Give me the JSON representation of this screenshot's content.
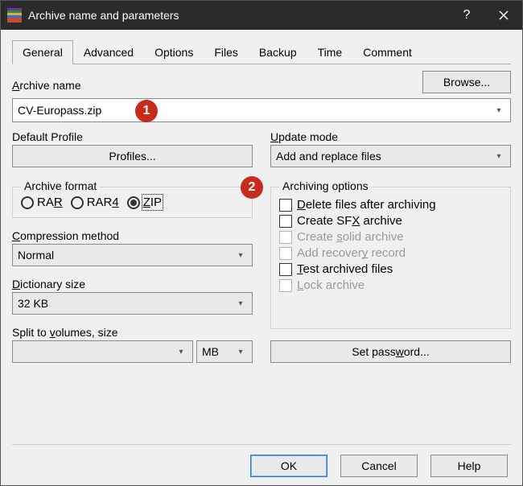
{
  "window": {
    "title": "Archive name and parameters"
  },
  "tabs": {
    "general": "General",
    "advanced": "Advanced",
    "options": "Options",
    "files": "Files",
    "backup": "Backup",
    "time": "Time",
    "comment": "Comment"
  },
  "general": {
    "archive_name_label_pre": "A",
    "archive_name_label_post": "rchive name",
    "browse": "Browse...",
    "archive_name_value": "CV-Europass.zip",
    "default_profile_label": "Default Profile",
    "profiles_btn": "Profiles...",
    "update_mode_label_u": "U",
    "update_mode_label_rest": "pdate mode",
    "update_mode_value": "Add and replace files",
    "archive_format_label": "Archive format",
    "fmt_rar_pre": "RA",
    "fmt_rar_u": "R",
    "fmt_rar4_pre": "RAR",
    "fmt_rar4_u": "4",
    "fmt_zip_u": "Z",
    "fmt_zip_post": "IP",
    "compression_label_u": "C",
    "compression_label_rest": "ompression method",
    "compression_value": "Normal",
    "dictionary_label_u": "D",
    "dictionary_label_rest": "ictionary size",
    "dictionary_value": "32 KB",
    "split_label_pre": "Split to ",
    "split_label_u": "v",
    "split_label_post": "olumes, size",
    "split_value": "",
    "split_unit": "MB",
    "archiving_options_label": "Archiving options",
    "opt_delete_u": "D",
    "opt_delete_rest": "elete files after archiving",
    "opt_sfx_pre": "Create SF",
    "opt_sfx_u": "X",
    "opt_sfx_post": " archive",
    "opt_solid_pre": "Create ",
    "opt_solid_u": "s",
    "opt_solid_post": "olid archive",
    "opt_recovery_pre": "Add recover",
    "opt_recovery_u": "y",
    "opt_recovery_post": " record",
    "opt_test_u": "T",
    "opt_test_rest": "est archived files",
    "opt_lock_u": "L",
    "opt_lock_rest": "ock archive",
    "set_password_pre": "Set pass",
    "set_password_u": "w",
    "set_password_post": "ord..."
  },
  "footer": {
    "ok": "OK",
    "cancel": "Cancel",
    "help": "Help"
  },
  "callouts": {
    "one": "1",
    "two": "2"
  }
}
